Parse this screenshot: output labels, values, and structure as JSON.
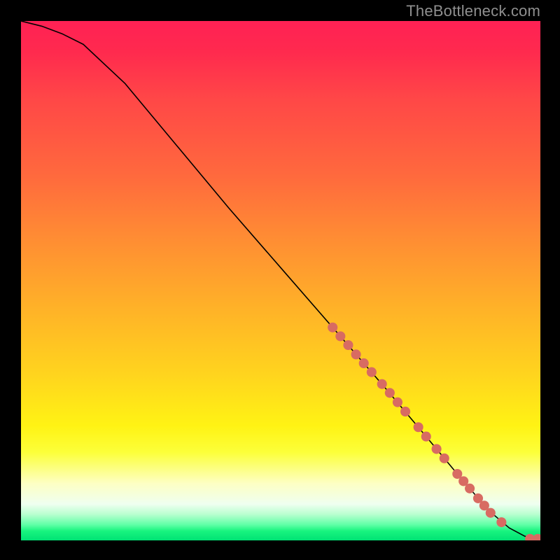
{
  "watermark": "TheBottleneck.com",
  "chart_data": {
    "type": "line",
    "title": "",
    "xlabel": "",
    "ylabel": "",
    "xlim": [
      0,
      100
    ],
    "ylim": [
      0,
      100
    ],
    "grid": false,
    "legend": false,
    "curve": {
      "x": [
        0,
        4,
        8,
        12,
        20,
        30,
        40,
        50,
        60,
        70,
        78,
        84,
        90,
        94,
        97,
        99,
        100
      ],
      "y": [
        100,
        99,
        97.5,
        95.5,
        88,
        76,
        64,
        52.5,
        41,
        29.5,
        20,
        12.8,
        5.8,
        2.4,
        0.8,
        0.3,
        0.3
      ]
    },
    "markers": {
      "color": "#d86b62",
      "radius_plot_units": 0.95,
      "points": [
        {
          "x": 60.0,
          "y": 41.0
        },
        {
          "x": 61.5,
          "y": 39.3
        },
        {
          "x": 63.0,
          "y": 37.6
        },
        {
          "x": 64.5,
          "y": 35.8
        },
        {
          "x": 66.0,
          "y": 34.1
        },
        {
          "x": 67.5,
          "y": 32.4
        },
        {
          "x": 69.5,
          "y": 30.1
        },
        {
          "x": 71.0,
          "y": 28.4
        },
        {
          "x": 72.5,
          "y": 26.6
        },
        {
          "x": 74.0,
          "y": 24.8
        },
        {
          "x": 76.5,
          "y": 21.8
        },
        {
          "x": 78.0,
          "y": 20.0
        },
        {
          "x": 80.0,
          "y": 17.6
        },
        {
          "x": 81.5,
          "y": 15.8
        },
        {
          "x": 84.0,
          "y": 12.8
        },
        {
          "x": 85.2,
          "y": 11.4
        },
        {
          "x": 86.4,
          "y": 10.0
        },
        {
          "x": 88.0,
          "y": 8.1
        },
        {
          "x": 89.2,
          "y": 6.7
        },
        {
          "x": 90.4,
          "y": 5.3
        },
        {
          "x": 92.5,
          "y": 3.5
        },
        {
          "x": 98.0,
          "y": 0.3
        },
        {
          "x": 99.5,
          "y": 0.3
        }
      ]
    },
    "background_gradient_stops": [
      {
        "pct": 0,
        "color": "#ff2154"
      },
      {
        "pct": 15,
        "color": "#ff4747"
      },
      {
        "pct": 42,
        "color": "#ff8d33"
      },
      {
        "pct": 68,
        "color": "#ffd41e"
      },
      {
        "pct": 83,
        "color": "#fcff39"
      },
      {
        "pct": 93,
        "color": "#effff0"
      },
      {
        "pct": 100,
        "color": "#00e274"
      }
    ]
  }
}
